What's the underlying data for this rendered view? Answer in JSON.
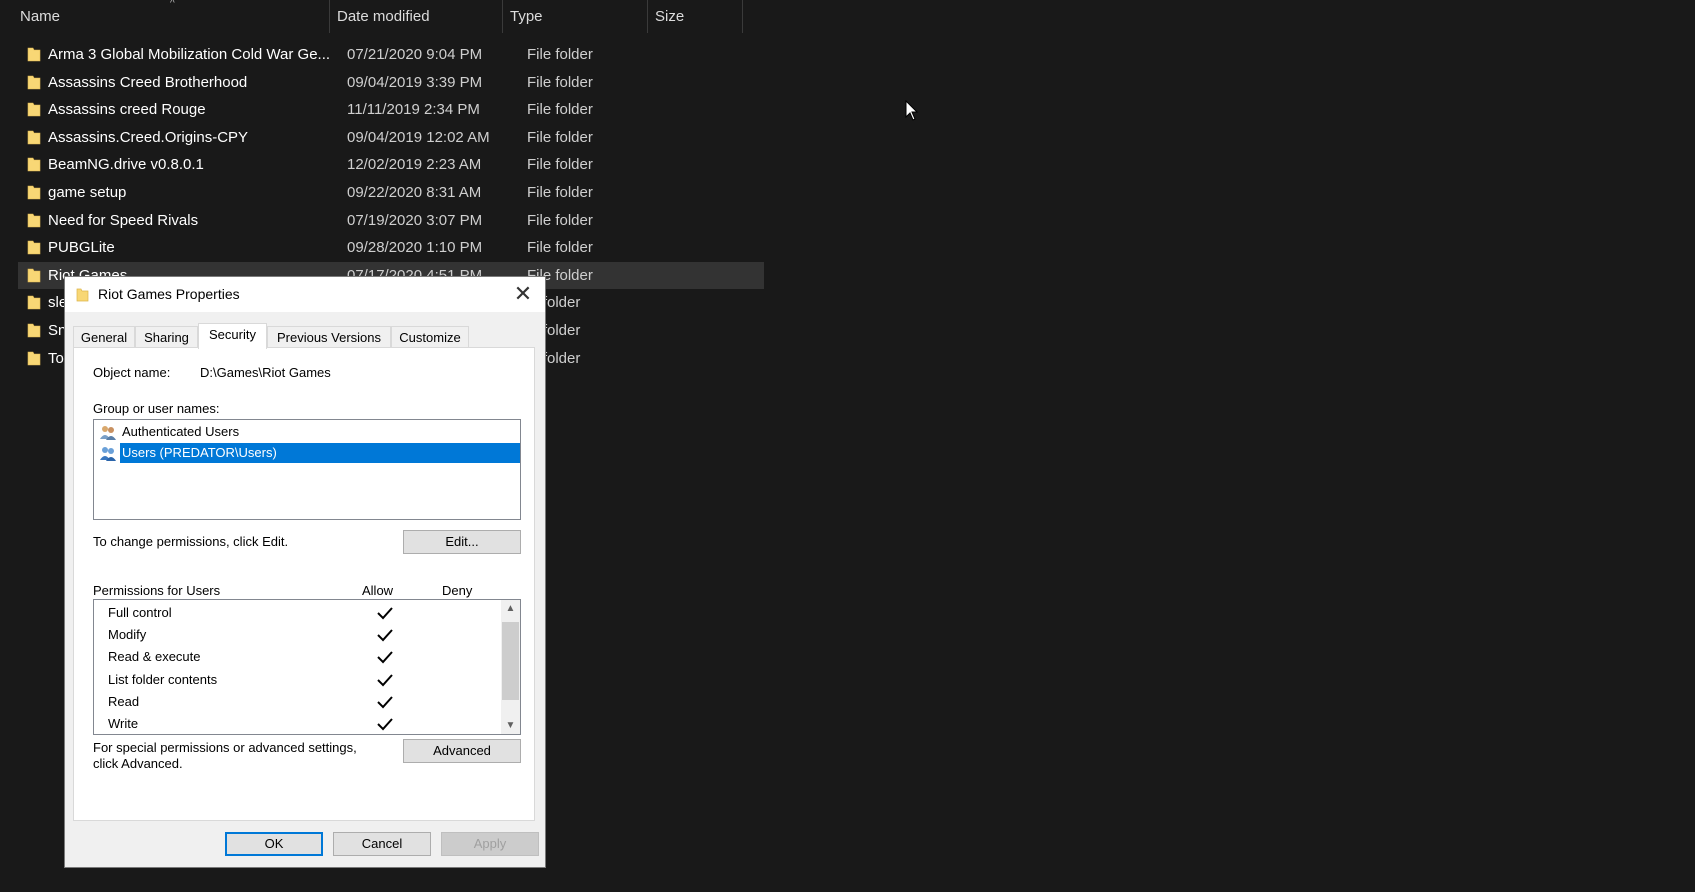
{
  "columns": {
    "name": "Name",
    "date": "Date modified",
    "type": "Type",
    "size": "Size"
  },
  "files": [
    {
      "name": "Arma 3 Global Mobilization Cold War Ge...",
      "date": "07/21/2020 9:04 PM",
      "type": "File folder",
      "size": ""
    },
    {
      "name": "Assassins Creed Brotherhood",
      "date": "09/04/2019 3:39 PM",
      "type": "File folder",
      "size": ""
    },
    {
      "name": "Assassins creed Rouge",
      "date": "11/11/2019 2:34 PM",
      "type": "File folder",
      "size": ""
    },
    {
      "name": "Assassins.Creed.Origins-CPY",
      "date": "09/04/2019 12:02 AM",
      "type": "File folder",
      "size": ""
    },
    {
      "name": "BeamNG.drive v0.8.0.1",
      "date": "12/02/2019 2:23 AM",
      "type": "File folder",
      "size": ""
    },
    {
      "name": "game setup",
      "date": "09/22/2020 8:31 AM",
      "type": "File folder",
      "size": ""
    },
    {
      "name": "Need for Speed Rivals",
      "date": "07/19/2020 3:07 PM",
      "type": "File folder",
      "size": ""
    },
    {
      "name": "PUBGLite",
      "date": "09/28/2020 1:10 PM",
      "type": "File folder",
      "size": ""
    },
    {
      "name": "Riot Games",
      "date": "07/17/2020 4:51 PM",
      "type": "File folder",
      "size": ""
    },
    {
      "name": "sle",
      "date": "",
      "type": "le folder",
      "size": ""
    },
    {
      "name": "Sn",
      "date": "",
      "type": "le folder",
      "size": ""
    },
    {
      "name": "To",
      "date": "",
      "type": "le folder",
      "size": ""
    }
  ],
  "dialog": {
    "title": "Riot Games Properties",
    "close_label": "✕",
    "tabs": [
      "General",
      "Sharing",
      "Security",
      "Previous Versions",
      "Customize"
    ],
    "object_name_label": "Object name:",
    "object_name_value": "D:\\Games\\Riot Games",
    "group_label": "Group or user names:",
    "users": [
      "Authenticated Users",
      "Users (PREDATOR\\Users)"
    ],
    "change_hint": "To change permissions, click Edit.",
    "edit_button": "Edit...",
    "permissions_label": "Permissions for Users",
    "allow_label": "Allow",
    "deny_label": "Deny",
    "permissions": [
      {
        "name": "Full control",
        "allow": true,
        "deny": false
      },
      {
        "name": "Modify",
        "allow": true,
        "deny": false
      },
      {
        "name": "Read & execute",
        "allow": true,
        "deny": false
      },
      {
        "name": "List folder contents",
        "allow": true,
        "deny": false
      },
      {
        "name": "Read",
        "allow": true,
        "deny": false
      },
      {
        "name": "Write",
        "allow": true,
        "deny": false
      }
    ],
    "advanced_hint_line1": "For special permissions or advanced settings,",
    "advanced_hint_line2": "click Advanced.",
    "advanced_button": "Advanced",
    "ok_button": "OK",
    "cancel_button": "Cancel",
    "apply_button": "Apply"
  },
  "colors": {
    "selection": "#0078d7",
    "folder": "#f8d775",
    "explorer_bg": "#191919"
  }
}
